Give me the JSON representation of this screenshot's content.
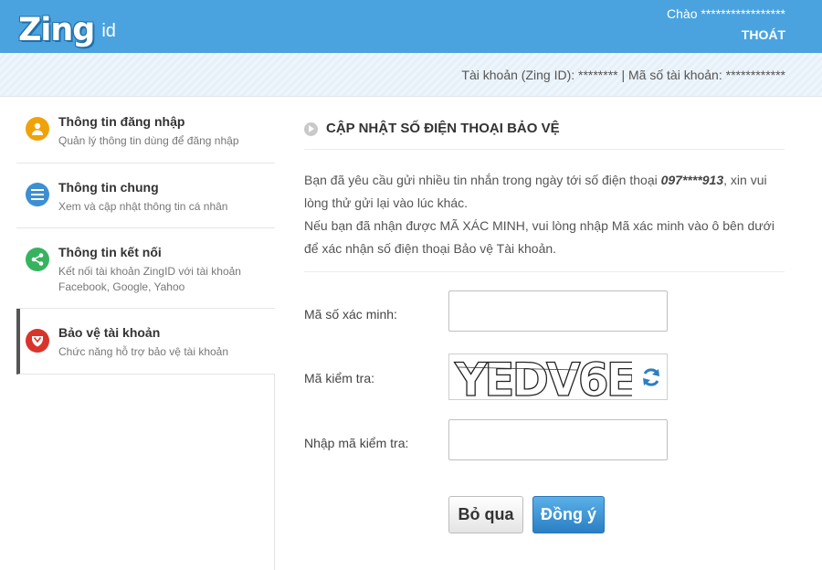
{
  "header": {
    "logo_text": "Zing",
    "logo_suffix": "id",
    "greeting": "Chào *****************",
    "logout": "THOÁT"
  },
  "account_bar": {
    "text": "Tài khoản (Zing ID): ******** | Mã số tài khoản: ************"
  },
  "sidebar": {
    "items": [
      {
        "title": "Thông tin đăng nhập",
        "subtitle": "Quản lý thông tin dùng để đăng nhập",
        "icon": "user-icon",
        "color": "#f0a20a"
      },
      {
        "title": "Thông tin chung",
        "subtitle": "Xem và cập nhật thông tin cá nhân",
        "icon": "list-icon",
        "color": "#3d8fd1"
      },
      {
        "title": "Thông tin kết nối",
        "subtitle": "Kết nối tài khoản ZingID với tài khoản Facebook, Google, Yahoo",
        "icon": "share-icon",
        "color": "#37b35f"
      },
      {
        "title": "Bảo vệ tài khoản",
        "subtitle": "Chức năng hỗ trợ bảo vệ tài khoản",
        "icon": "shield-icon",
        "color": "#d9342b"
      }
    ]
  },
  "main": {
    "title": "CẬP NHẬT SỐ ĐIỆN THOẠI BẢO VỆ",
    "message_part1": "Bạn đã yêu cầu gửi nhiều tin nhắn trong ngày tới số điện thoại ",
    "phone": "097****913",
    "message_part2": ", xin vui lòng thử gửi lại vào lúc khác.",
    "message_line2": "Nếu bạn đã nhận được MÃ XÁC MINH, vui lòng nhập Mã xác minh vào ô bên dưới để xác nhận số điện thoại Bảo vệ Tài khoản.",
    "labels": {
      "verify_code": "Mã số xác minh:",
      "captcha": "Mã kiểm tra:",
      "captcha_input": "Nhập mã kiểm tra:"
    },
    "captcha_text": "YEDV6E",
    "buttons": {
      "skip": "Bỏ qua",
      "ok": "Đồng ý"
    }
  },
  "colors": {
    "header_bg": "#4aa3df",
    "primary_button": "#2a7fc4"
  }
}
